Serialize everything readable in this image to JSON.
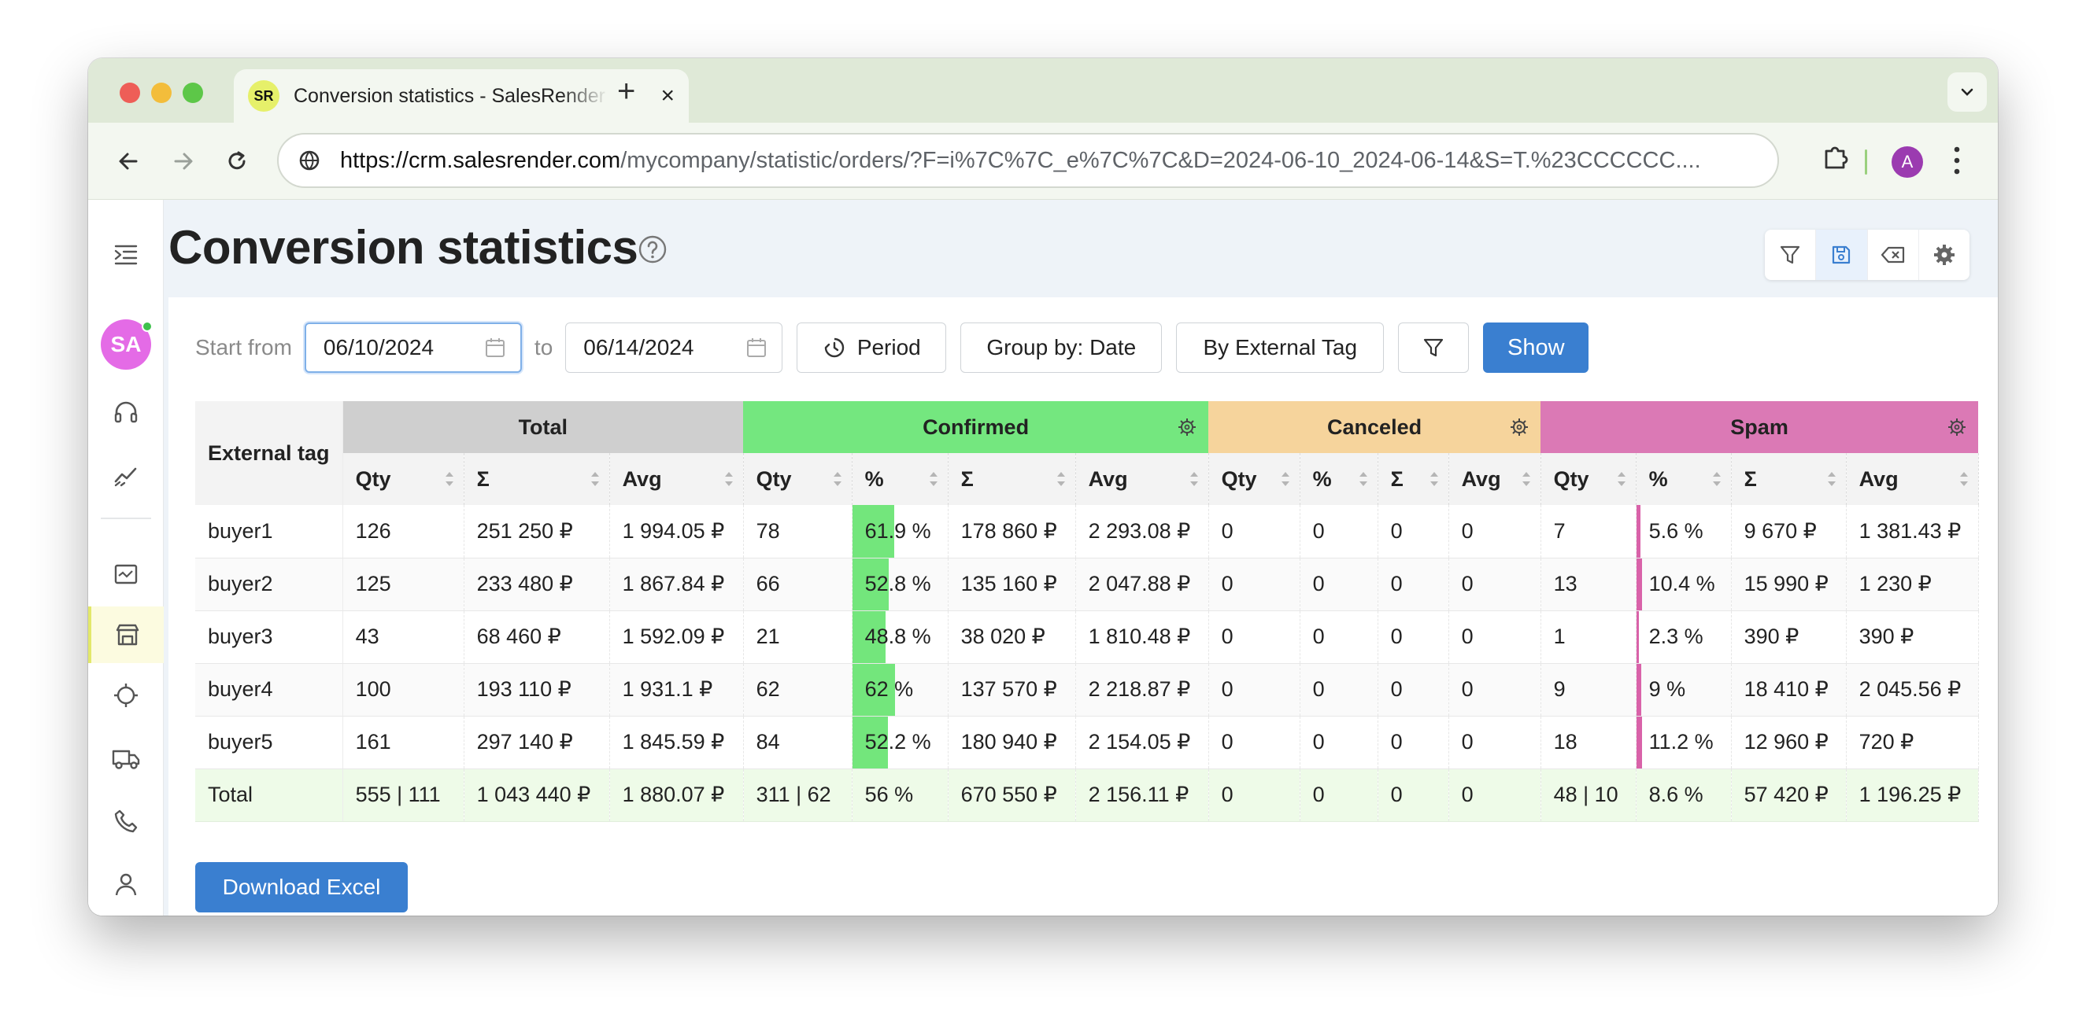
{
  "browser": {
    "tab_title": "Conversion statistics - SalesRender",
    "favicon_text": "SR",
    "tab_close": "×",
    "new_tab": "+",
    "url_host": "https://crm.salesrender.com",
    "url_path": "/mycompany/statistic/orders/?F=i%7C%7C_e%7C%7C&D=2024-06-10_2024-06-14&S=T.%23CCCCCC....",
    "profile_initial": "A"
  },
  "sidebar": {
    "avatar_initials": "SA",
    "icons": [
      "menu-indent-icon",
      "headset-icon",
      "trend-chart-icon",
      "dashboard-icon",
      "store-icon",
      "crosshair-icon",
      "truck-icon",
      "phone-icon",
      "user-icon"
    ]
  },
  "page": {
    "title": "Conversion statistics",
    "actions": [
      "filter-icon",
      "save-icon",
      "clear-icon",
      "settings-icon"
    ]
  },
  "filters": {
    "start_label": "Start from",
    "start_date": "06/10/2024",
    "to_label": "to",
    "end_date": "06/14/2024",
    "period": "Period",
    "group_by": "Group by: Date",
    "by_tag": "By External Tag",
    "show": "Show"
  },
  "table": {
    "ext_header": "External tag",
    "groups": {
      "total": "Total",
      "confirmed": "Confirmed",
      "canceled": "Canceled",
      "spam": "Spam"
    },
    "sub": {
      "qty": "Qty",
      "pct": "%",
      "sum": "Σ",
      "avg": "Avg"
    },
    "rows": [
      {
        "tag": "buyer1",
        "t_qty": "126",
        "t_sum": "251 250 ₽",
        "t_avg": "1 994.05 ₽",
        "c_qty": "78",
        "c_pct": "61.9 %",
        "c_sum": "178 860 ₽",
        "c_avg": "2 293.08 ₽",
        "x_qty": "0",
        "x_pct": "0",
        "x_sum": "0",
        "x_avg": "0",
        "s_qty": "7",
        "s_pct": "5.6 %",
        "s_sum": "9 670 ₽",
        "s_avg": "1 381.43 ₽"
      },
      {
        "tag": "buyer2",
        "t_qty": "125",
        "t_sum": "233 480 ₽",
        "t_avg": "1 867.84 ₽",
        "c_qty": "66",
        "c_pct": "52.8 %",
        "c_sum": "135 160 ₽",
        "c_avg": "2 047.88 ₽",
        "x_qty": "0",
        "x_pct": "0",
        "x_sum": "0",
        "x_avg": "0",
        "s_qty": "13",
        "s_pct": "10.4 %",
        "s_sum": "15 990 ₽",
        "s_avg": "1 230 ₽"
      },
      {
        "tag": "buyer3",
        "t_qty": "43",
        "t_sum": "68 460 ₽",
        "t_avg": "1 592.09 ₽",
        "c_qty": "21",
        "c_pct": "48.8 %",
        "c_sum": "38 020 ₽",
        "c_avg": "1 810.48 ₽",
        "x_qty": "0",
        "x_pct": "0",
        "x_sum": "0",
        "x_avg": "0",
        "s_qty": "1",
        "s_pct": "2.3 %",
        "s_sum": "390 ₽",
        "s_avg": "390 ₽"
      },
      {
        "tag": "buyer4",
        "t_qty": "100",
        "t_sum": "193 110 ₽",
        "t_avg": "1 931.1 ₽",
        "c_qty": "62",
        "c_pct": "62 %",
        "c_sum": "137 570 ₽",
        "c_avg": "2 218.87 ₽",
        "x_qty": "0",
        "x_pct": "0",
        "x_sum": "0",
        "x_avg": "0",
        "s_qty": "9",
        "s_pct": "9 %",
        "s_sum": "18 410 ₽",
        "s_avg": "2 045.56 ₽"
      },
      {
        "tag": "buyer5",
        "t_qty": "161",
        "t_sum": "297 140 ₽",
        "t_avg": "1 845.59 ₽",
        "c_qty": "84",
        "c_pct": "52.2 %",
        "c_sum": "180 940 ₽",
        "c_avg": "2 154.05 ₽",
        "x_qty": "0",
        "x_pct": "0",
        "x_sum": "0",
        "x_avg": "0",
        "s_qty": "18",
        "s_pct": "11.2 %",
        "s_sum": "12 960 ₽",
        "s_avg": "720 ₽"
      }
    ],
    "total": {
      "tag": "Total",
      "t_qty": "555 | 111",
      "t_sum": "1 043 440 ₽",
      "t_avg": "1 880.07 ₽",
      "c_qty": "311 | 62",
      "c_pct": "56 %",
      "c_sum": "670 550 ₽",
      "c_avg": "2 156.11 ₽",
      "x_qty": "0",
      "x_pct": "0",
      "x_sum": "0",
      "x_avg": "0",
      "s_qty": "48 | 10",
      "s_pct": "8.6 %",
      "s_sum": "57 420 ₽",
      "s_avg": "1 196.25 ₽"
    },
    "colors": {
      "total": "#cfcfcf",
      "confirmed": "#74e77f",
      "canceled": "#f6d49c",
      "spam": "#db79b5"
    }
  },
  "download_label": "Download Excel"
}
